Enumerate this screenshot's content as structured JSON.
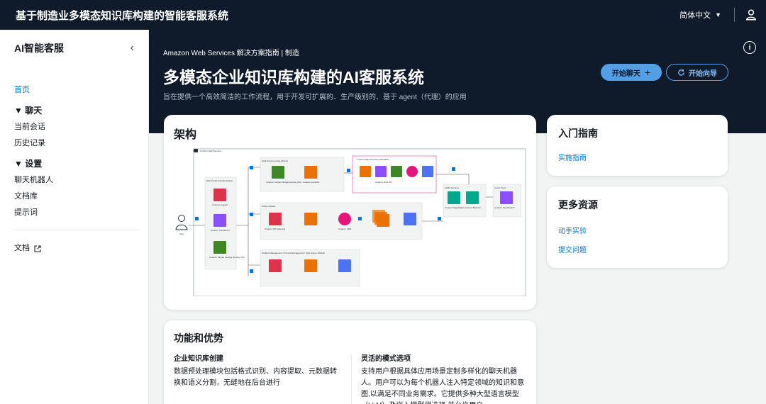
{
  "topbar": {
    "title": "基于制造业多模态知识库构建的智能客服系统",
    "language": "简体中文"
  },
  "sidebar": {
    "app_name": "AI智能客服",
    "home": "首页",
    "chat_section": "聊天",
    "chat_items": [
      "当前会话",
      "历史记录"
    ],
    "settings_section": "设置",
    "settings_items": [
      "聊天机器人",
      "文档库",
      "提示词"
    ],
    "docs": "文档"
  },
  "hero": {
    "breadcrumb": "Amazon Web Services 解决方案指南 | 制造",
    "title": "多模态企业知识库构建的AI客服系统",
    "description": "旨在提供一个高效简洁的工作流程，用于开发可扩展的、生产级别的、基于 agent（代理）的应用",
    "start_chat": "开始聊天",
    "start_wizard": "开始向导"
  },
  "architecture": {
    "title": "架构",
    "diagram": {
      "cloud_label": "Amazon Web Services",
      "user_label": "User",
      "web_portal_label": "Web Portal & Authentication",
      "data_module_label": "Data Preprocessing Module",
      "step_functions_label": "Amazon Step Functions Workflow",
      "online_module_label": "Online Module",
      "chatbot_module_label": "Chatbot Management / Prompt Management / Chat History Module",
      "aiml_label": "AI/ML Services",
      "vector_label": "Vector Store",
      "services": {
        "cognito": "Amazon Cognito",
        "cloudfront": "Amazon CloudFront",
        "s3": "Amazon Simple Storage Service (S3)",
        "lambda": "Amazon Lambda",
        "glue": "Amazon Glue Job",
        "sqs": "Amazon SQS",
        "dynamodb": "Amazon DynamoDB",
        "apigw": "Amazon API Gateway",
        "sagemaker": "Amazon SageMaker",
        "bedrock": "Amazon Bedrock",
        "opensearch": "Amazon OpenSearch"
      },
      "step_numbers": [
        "1",
        "2",
        "3",
        "4",
        "5",
        "6",
        "7"
      ]
    }
  },
  "getting_started": {
    "title": "入门指南",
    "links": [
      "实施指南"
    ]
  },
  "more_resources": {
    "title": "更多资源",
    "links": [
      "动手实验",
      "提交问题"
    ]
  },
  "features": {
    "title": "功能和优势",
    "col1_title": "企业知识库创建",
    "col1_text": "数据预处理模块包括格式识别、内容提取、元数据转换和语义分割，无缝地在后台进行",
    "col2_title": "灵活的模式选项",
    "col2_text": "支持用户根据具体应用场景定制多样化的聊天机器人。用户可以为每个机器人注入特定领域的知识和意图,以满足不同业务需求。它提供多种大型语言模型（LLM）及嵌入模型供选择,并允许用户"
  },
  "colors": {
    "dark_bg": "#0f1b2a",
    "accent": "#539fe5",
    "link": "#0972d3",
    "lambda": "#ed7100",
    "s3": "#3f8624",
    "security": "#dd344c",
    "network": "#8c4fff",
    "database": "#4d72f3",
    "ml": "#01a88d"
  }
}
